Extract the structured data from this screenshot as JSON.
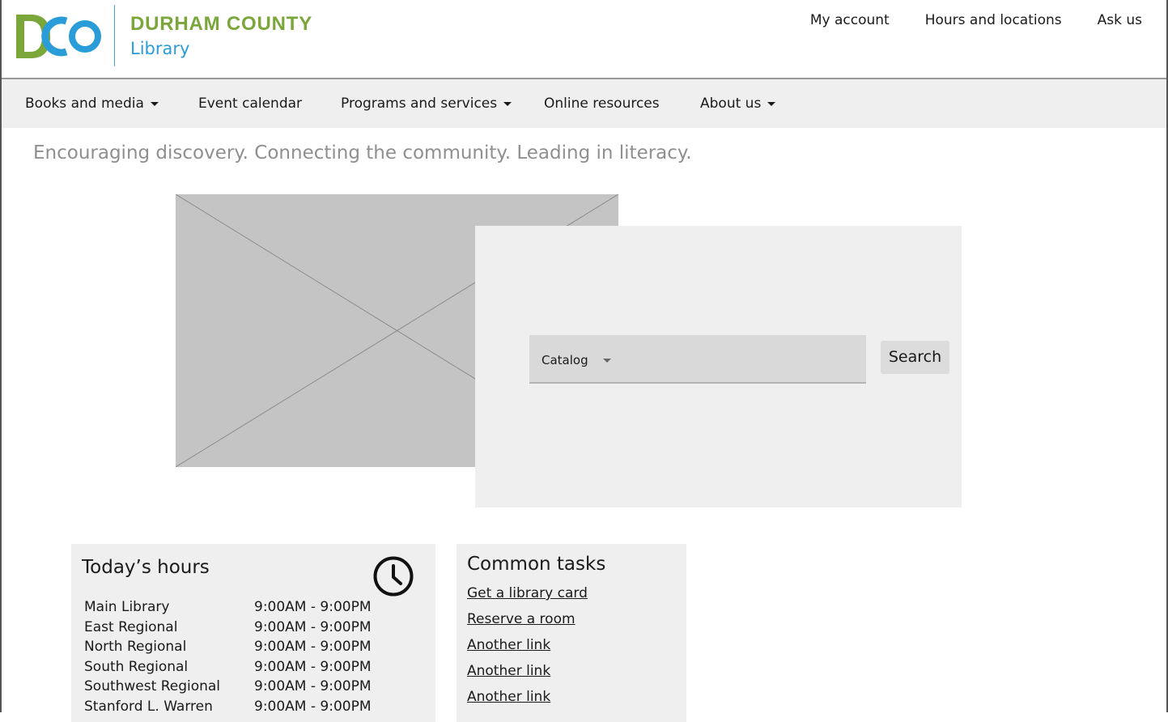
{
  "header": {
    "logo_text_line1": "DURHAM COUNTY",
    "logo_text_line2": "Library",
    "utility_links": [
      "My account",
      "Hours and locations",
      "Ask us"
    ]
  },
  "nav": {
    "items": [
      {
        "label": "Books and media",
        "has_dropdown": true
      },
      {
        "label": "Event calendar",
        "has_dropdown": false
      },
      {
        "label": "Programs and services",
        "has_dropdown": true
      },
      {
        "label": "Online resources",
        "has_dropdown": false
      },
      {
        "label": "About us",
        "has_dropdown": true
      }
    ]
  },
  "tagline": "Encouraging discovery. Connecting the community. Leading in literacy.",
  "search": {
    "scope_selected": "Catalog",
    "button_label": "Search"
  },
  "hours": {
    "title": "Today’s hours",
    "rows": [
      {
        "location": "Main Library",
        "time": "9:00AM - 9:00PM"
      },
      {
        "location": "East Regional",
        "time": "9:00AM - 9:00PM"
      },
      {
        "location": "North Regional",
        "time": "9:00AM - 9:00PM"
      },
      {
        "location": "South Regional",
        "time": "9:00AM - 9:00PM"
      },
      {
        "location": "Southwest Regional",
        "time": "9:00AM - 9:00PM"
      },
      {
        "location": "Stanford L. Warren",
        "time": "9:00AM - 9:00PM"
      }
    ]
  },
  "tasks": {
    "title": "Common tasks",
    "links": [
      "Get a library card",
      "Reserve a room",
      "Another link",
      "Another link",
      "Another link"
    ]
  },
  "colors": {
    "brand_green": "#7aa63a",
    "brand_blue": "#2a9cd8",
    "panel_gray": "#efefef",
    "placeholder_gray": "#c4c4c4"
  }
}
